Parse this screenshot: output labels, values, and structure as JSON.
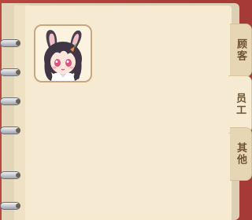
{
  "tabs": [
    {
      "label": "顾客",
      "active": false
    },
    {
      "label": "员工",
      "active": true
    },
    {
      "label": "其他",
      "active": false
    }
  ],
  "staff": [
    {
      "portrait": "bunny-ear-girl-portrait"
    }
  ],
  "colors": {
    "cover": "#a93b38",
    "page": "#f6ebd2",
    "tab_text": "#6e5432"
  }
}
